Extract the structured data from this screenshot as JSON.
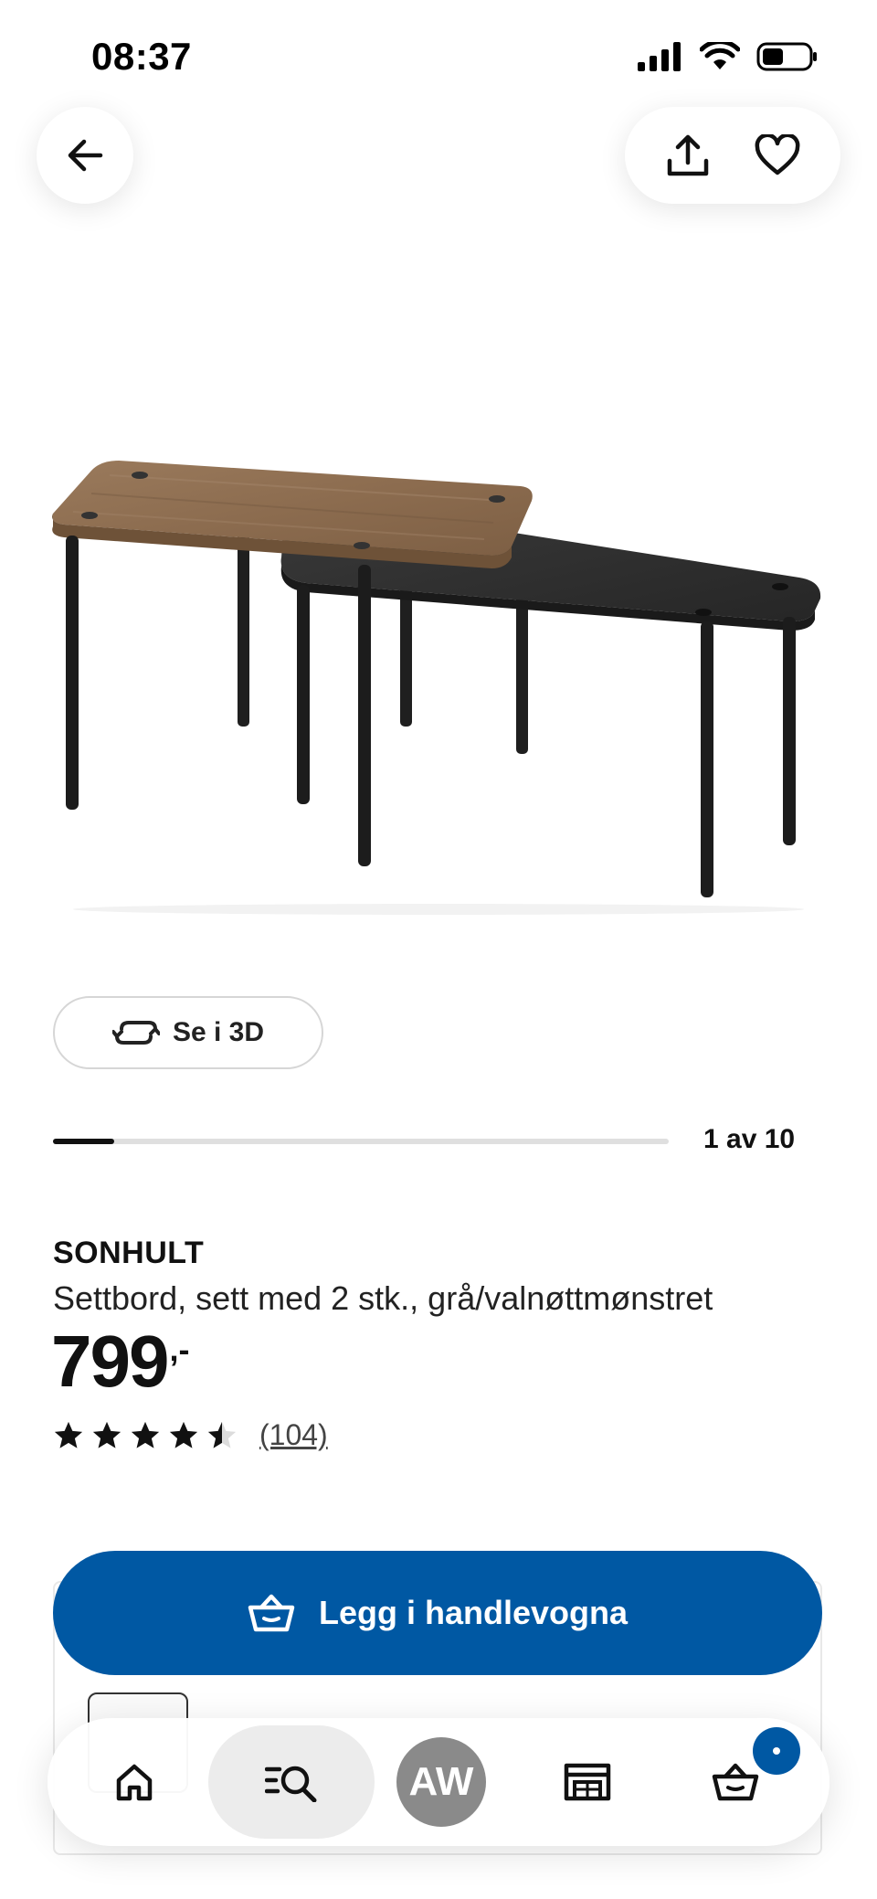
{
  "status_bar": {
    "time": "08:37"
  },
  "header": {
    "back_icon": "arrow-left-icon",
    "share_icon": "share-icon",
    "favorite_icon": "heart-icon"
  },
  "gallery": {
    "see_3d_label": "Se i 3D",
    "counter": "1 av 10",
    "progress": 0.1
  },
  "product": {
    "name": "SONHULT",
    "description": "Settbord, sett med 2 stk., grå/valnøttmønstret",
    "price": "799",
    "price_suffix": ",-",
    "rating": 4.5,
    "review_count": "(104)"
  },
  "cart_button": {
    "label": "Legg i handlevogna",
    "icon": "basket-icon"
  },
  "bottom_nav": {
    "avatar_initials": "AW",
    "items": [
      "home-icon",
      "search-icon",
      "avatar",
      "store-icon",
      "basket-icon"
    ]
  },
  "colors": {
    "primary": "#0058a3",
    "wood": "#8a6b4e",
    "dark_table": "#2e2e2e"
  }
}
